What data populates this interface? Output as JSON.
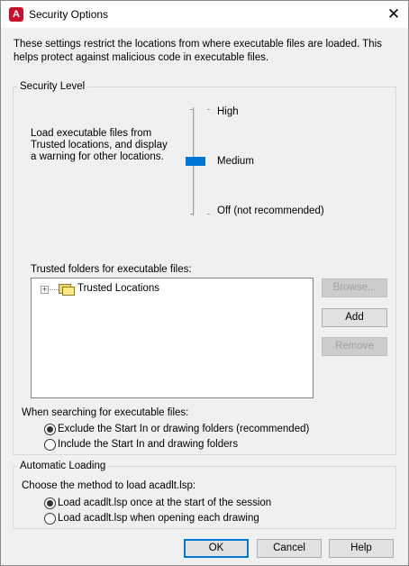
{
  "window": {
    "title": "Security Options",
    "app_icon_glyph": "A",
    "close_glyph": "✕"
  },
  "intro_text": "These settings restrict the locations from where executable files are loaded.  This helps protect against malicious code in executable files.",
  "security_level": {
    "group_label": "Security Level",
    "description_lines": [
      "Load executable files from",
      "Trusted locations, and display",
      "a warning for other locations."
    ],
    "levels": [
      "High",
      "Medium",
      "Off (not recommended)"
    ],
    "selected_level": "Medium"
  },
  "trusted_folders": {
    "label": "Trusted folders for executable files:",
    "tree": [
      {
        "label": "Trusted Locations",
        "expander": "+",
        "icon": "folder-icon"
      }
    ],
    "buttons": {
      "browse": "Browse...",
      "add": "Add",
      "remove": "Remove"
    }
  },
  "search_options": {
    "label": "When searching for executable files:",
    "options": [
      {
        "label": "Exclude the Start In or drawing folders (recommended)",
        "checked": true
      },
      {
        "label": "Include the Start In and drawing folders",
        "checked": false
      }
    ]
  },
  "automatic_loading": {
    "group_label": "Automatic Loading",
    "prompt": "Choose the method to load acadlt.lsp:",
    "options": [
      {
        "label": "Load acadlt.lsp once at the start of the session",
        "checked": true
      },
      {
        "label": "Load acadlt.lsp when opening each drawing",
        "checked": false
      }
    ]
  },
  "footer": {
    "ok": "OK",
    "cancel": "Cancel",
    "help": "Help"
  },
  "colors": {
    "accent": "#0078d7",
    "brand": "#c8102e"
  }
}
